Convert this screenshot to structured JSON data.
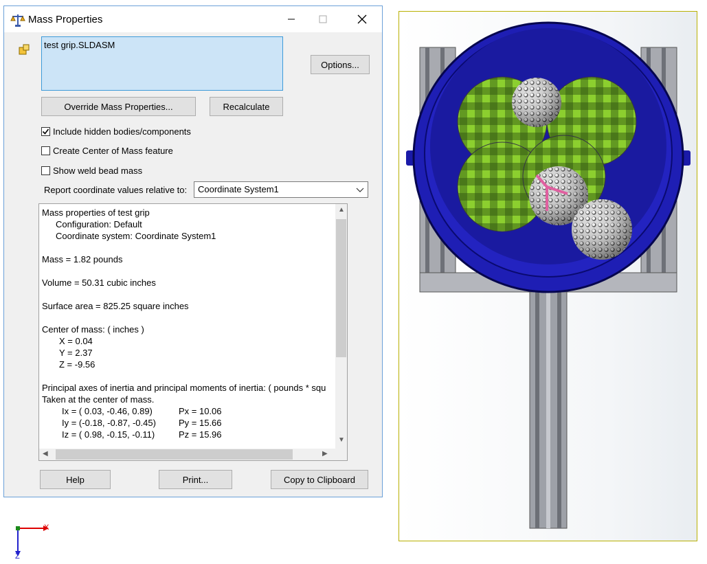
{
  "window": {
    "title": "Mass Properties"
  },
  "selection": {
    "items": [
      "test grip.SLDASM"
    ]
  },
  "buttons": {
    "options": "Options...",
    "override": "Override Mass Properties...",
    "recalculate": "Recalculate",
    "help": "Help",
    "print": "Print...",
    "copy": "Copy to Clipboard"
  },
  "checkboxes": {
    "include_hidden": {
      "label": "Include hidden bodies/components",
      "checked": true
    },
    "create_com": {
      "label": "Create Center of Mass feature",
      "checked": false
    },
    "weld_bead": {
      "label": "Show weld bead mass",
      "checked": false
    }
  },
  "coord": {
    "label": "Report coordinate values relative to:",
    "selected": "Coordinate System1"
  },
  "results": {
    "header": "Mass properties of test grip",
    "configuration": "Configuration: Default",
    "coordinate_system": "Coordinate system: Coordinate System1",
    "mass": "Mass = 1.82 pounds",
    "volume": "Volume = 50.31 cubic inches",
    "surface_area": "Surface area = 825.25 square inches",
    "com_header": "Center of mass: ( inches )",
    "com_x": "X = 0.04",
    "com_y": "Y = 2.37",
    "com_z": "Z = -9.56",
    "principal_header": "Principal axes of inertia and principal moments of inertia: ( pounds * squ",
    "taken_at": "Taken at the center of mass.",
    "axes": [
      {
        "axis": "Ix = ( 0.03, -0.46,  0.89)",
        "moment": "Px = 10.06"
      },
      {
        "axis": "Iy = (-0.18, -0.87, -0.45)",
        "moment": "Py = 15.66"
      },
      {
        "axis": "Iz = ( 0.98, -0.15, -0.11)",
        "moment": "Pz = 15.96"
      }
    ]
  },
  "triad": {
    "x_label": "X",
    "z_label": "Z"
  },
  "colors": {
    "selection_bg": "#cce4f7",
    "housing_blue": "#1a1aa8",
    "fabric_green": "#7fb82a",
    "frame_gray": "#a8aab0"
  }
}
